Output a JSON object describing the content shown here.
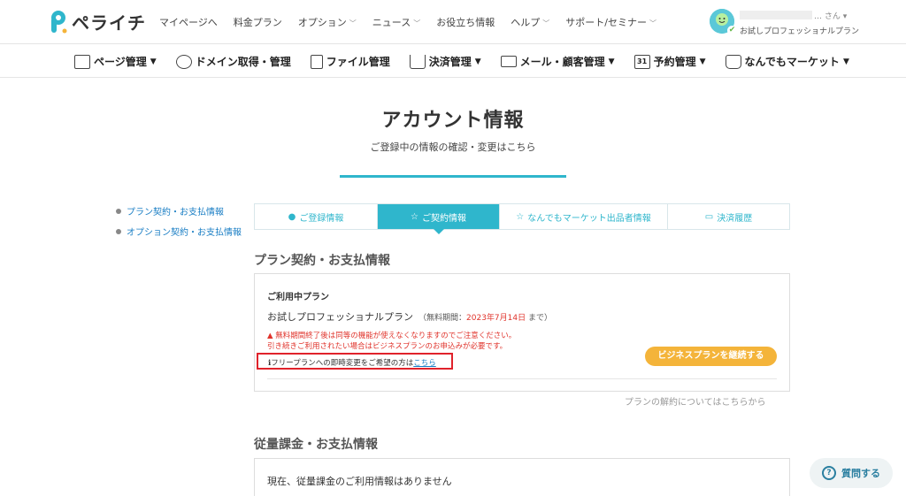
{
  "header": {
    "logo_text": "ペライチ",
    "nav": [
      {
        "label": "マイページへ",
        "dropdown": false
      },
      {
        "label": "料金プラン",
        "dropdown": false
      },
      {
        "label": "オプション",
        "dropdown": true
      },
      {
        "label": "ニュース",
        "dropdown": true
      },
      {
        "label": "お役立ち情報",
        "dropdown": false
      },
      {
        "label": "ヘルプ",
        "dropdown": true
      },
      {
        "label": "サポート/セミナー",
        "dropdown": true
      }
    ],
    "user": {
      "suffix": "… さん ▾",
      "plan": "お試しプロフェッショナルプラン"
    }
  },
  "mainnav": [
    {
      "label": "ページ管理",
      "dropdown": true,
      "icon": "page-icon"
    },
    {
      "label": "ドメイン取得・管理",
      "dropdown": false,
      "icon": "www-icon"
    },
    {
      "label": "ファイル管理",
      "dropdown": false,
      "icon": "file-icon"
    },
    {
      "label": "決済管理",
      "dropdown": true,
      "icon": "cart-icon"
    },
    {
      "label": "メール・顧客管理",
      "dropdown": true,
      "icon": "mail-icon"
    },
    {
      "label": "予約管理",
      "dropdown": true,
      "icon": "calendar-icon"
    },
    {
      "label": "なんでもマーケット",
      "dropdown": true,
      "icon": "bag-icon"
    }
  ],
  "page": {
    "title": "アカウント情報",
    "subtitle": "ご登録中の情報の確認・変更はこちら"
  },
  "sidenav": [
    {
      "label": "プラン契約・お支払情報"
    },
    {
      "label": "オプション契約・お支払情報"
    }
  ],
  "tabs": [
    {
      "label": "ご登録情報",
      "icon": "👤",
      "active": false
    },
    {
      "label": "ご契約情報",
      "icon": "☆",
      "active": true
    },
    {
      "label": "なんでもマーケット出品者情報",
      "icon": "☆",
      "active": false
    },
    {
      "label": "決済履歴",
      "icon": "▭",
      "active": false
    }
  ],
  "plan_section": {
    "heading": "プラン契約・お支払情報",
    "label": "ご利用中プラン",
    "plan_name": "お試しプロフェッショナルプラン",
    "trial_prefix": "（無料期間：",
    "trial_date": "2023年7月14日",
    "trial_suffix": " まで）",
    "warning_line1": "▲ 無料期間終了後は同等の機能が使えなくなりますのでご注意ください。",
    "warning_line2": "引き続きご利用されたい場合はビジネスプランのお申込みが必要です。",
    "free_text": "ℹフリープランへの即時変更をご希望の方は",
    "free_link": "こちら",
    "cta": "ビジネスプランを継続する",
    "cancel_link": "プランの解約についてはこちらから"
  },
  "usage_section": {
    "heading": "従量課金・お支払情報",
    "empty_text": "現在、従量課金のご利用情報はありません"
  },
  "help_button": "質問する",
  "colors": {
    "accent": "#2fb6cc",
    "cta": "#f4b43a",
    "alert": "#e0332b"
  }
}
